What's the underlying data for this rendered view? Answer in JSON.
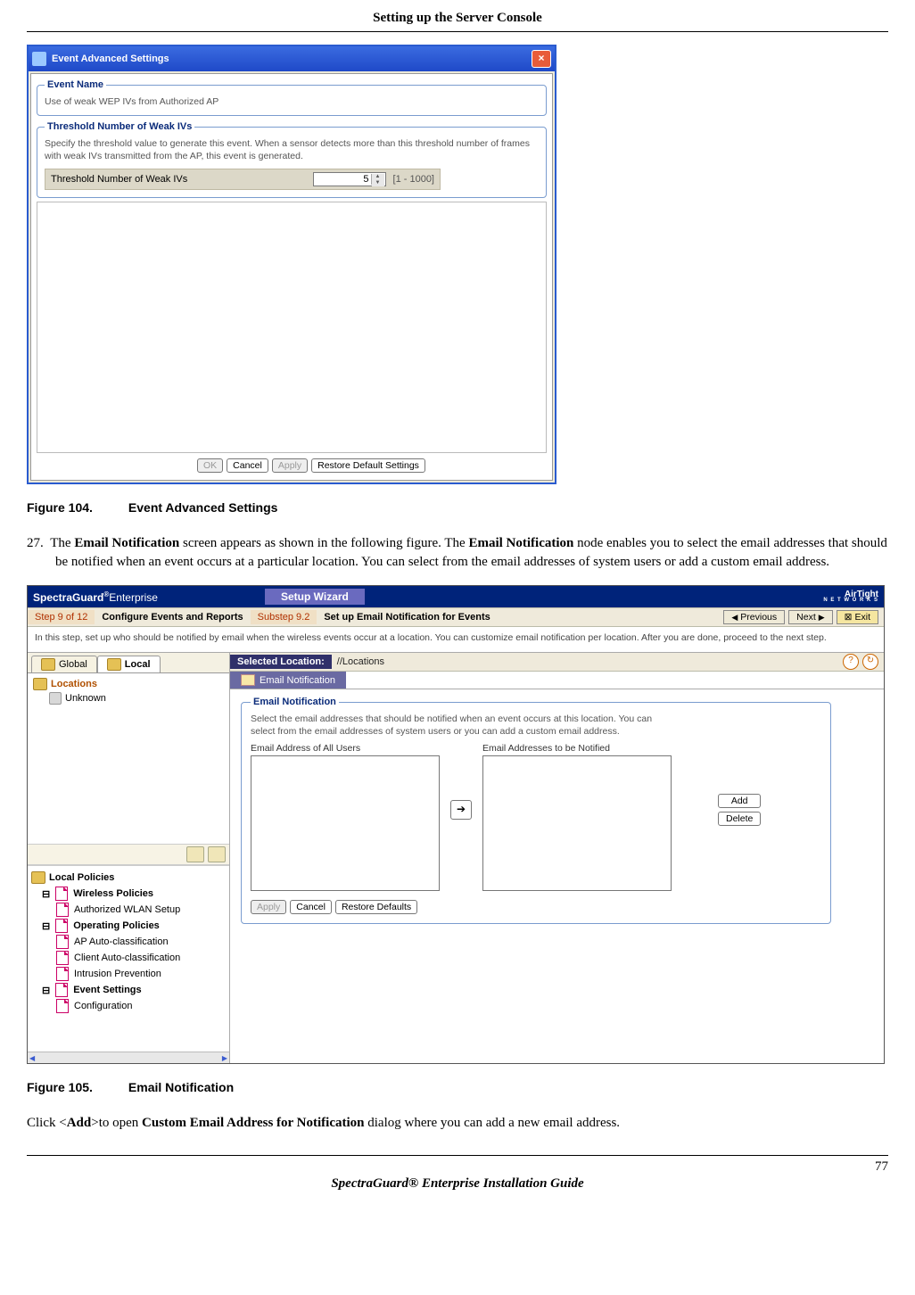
{
  "page": {
    "header": "Setting up the Server Console",
    "footer_title": "SpectraGuard® Enterprise Installation Guide",
    "page_number": "77"
  },
  "dialog1": {
    "title": "Event Advanced Settings",
    "groups": {
      "event_name_legend": "Event Name",
      "event_name_value": "Use of weak WEP IVs from Authorized AP",
      "threshold_legend": "Threshold Number of Weak IVs",
      "threshold_desc": "Specify the threshold value to generate this event. When a sensor detects more than this threshold number of frames with weak IVs transmitted from the AP, this event is generated.",
      "threshold_field_label": "Threshold Number of Weak IVs",
      "threshold_value": "5",
      "threshold_range": "[1 - 1000]"
    },
    "buttons": {
      "ok": "OK",
      "cancel": "Cancel",
      "apply": "Apply",
      "restore": "Restore Default Settings"
    }
  },
  "fig104": {
    "label": "Figure  104.",
    "title": "Event Advanced Settings"
  },
  "para27_num": "27.",
  "para27_a": "The ",
  "para27_b": "Email Notification",
  "para27_c": " screen appears as shown in the following figure. The ",
  "para27_d": "Email Notification",
  "para27_e": " node enables you to select the email addresses that should be notified when an event occurs at a particular location. You can select from the email addresses of system users or add a custom email address.",
  "wizard": {
    "brand_left_a": "SpectraGuard",
    "brand_left_b": "Enterprise",
    "setup_tab": "Setup Wizard",
    "brand_right_a": "AirTight",
    "brand_right_b": "N E T W O R K S",
    "step_label": "Step 9 of 12",
    "step_title": "Configure Events and Reports",
    "substep_label": "Substep 9.2",
    "substep_title": "Set up Email Notification for Events",
    "nav_prev": "Previous",
    "nav_next": "Next",
    "nav_exit": "Exit",
    "desc": "In this step, set up who should be notified by email when the wireless events occur at a location. You can customize email notification per location. After you are done, proceed to the next step.",
    "tabs": {
      "global": "Global",
      "local": "Local"
    },
    "tree": {
      "root": "Locations",
      "child": "Unknown"
    },
    "policies": {
      "header": "Local Policies",
      "wireless_grp": "Wireless Policies",
      "wireless_item1": "Authorized WLAN Setup",
      "operating_grp": "Operating Policies",
      "operating_item1": "AP Auto-classification",
      "operating_item2": "Client Auto-classification",
      "operating_item3": "Intrusion Prevention",
      "event_grp": "Event Settings",
      "event_item1": "Configuration"
    },
    "selected_location_label": "Selected Location:",
    "selected_location_path": "//Locations",
    "panel_tab": "Email Notification",
    "panel": {
      "legend": "Email Notification",
      "desc": "Select the email addresses that should be notified when an event occurs at this location. You can select from the email addresses of system users or you can add a custom email address.",
      "left_label": "Email Address of All Users",
      "right_label": "Email Addresses to be Notified",
      "add": "Add",
      "delete": "Delete",
      "apply": "Apply",
      "cancel": "Cancel",
      "restore": "Restore Defaults"
    }
  },
  "fig105": {
    "label": "Figure  105.",
    "title": "Email Notification"
  },
  "para_after_a": "Click <",
  "para_after_b": "Add",
  "para_after_c": ">to open ",
  "para_after_d": "Custom Email Address for Notification",
  "para_after_e": " dialog where you can add a new email address."
}
